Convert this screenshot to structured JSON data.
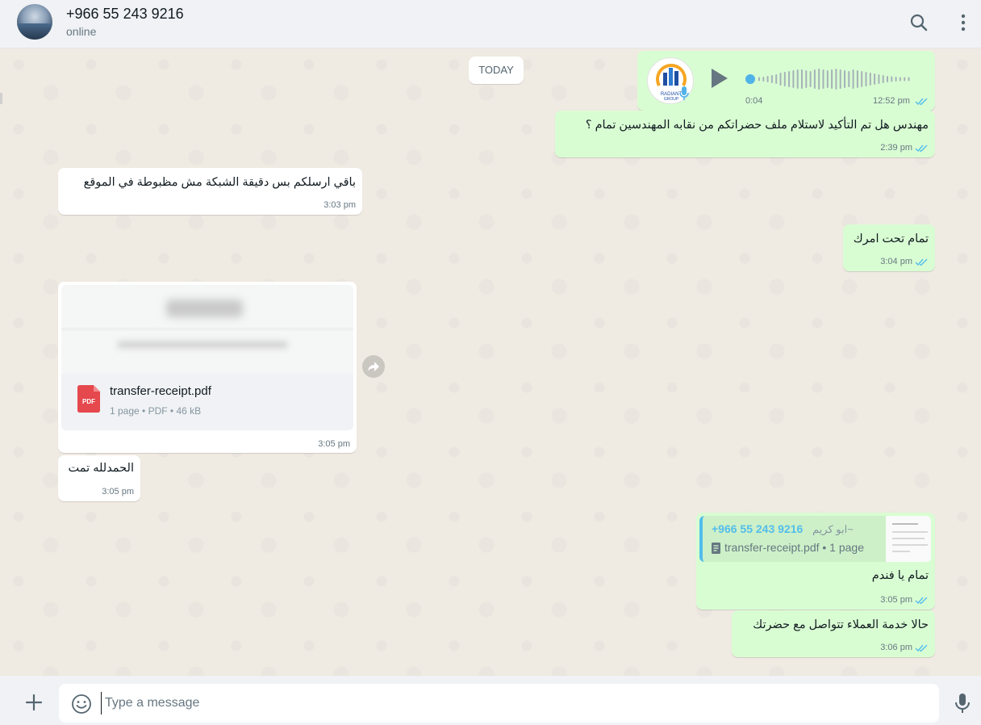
{
  "header": {
    "contact_name": "+966 55 243 9216",
    "status": "online",
    "icons": [
      "search-icon",
      "menu-icon"
    ]
  },
  "chat": {
    "date_divider": "TODAY",
    "voice_note": {
      "duration": "0:04",
      "time": "12:52 pm",
      "avatar_brand": "RADIANT GROUP"
    },
    "messages": [
      {
        "dir": "out",
        "text": "مهندس هل تم التأكيد لاستلام ملف حضراتكم من نقابه المهندسين تمام ؟",
        "time": "2:39 pm"
      },
      {
        "dir": "in",
        "text": "باقي ارسلكم بس دقيقة الشبكة مش مظبوطة في الموقع",
        "time": "3:03 pm"
      },
      {
        "dir": "out",
        "text": "تمام تحت امرك",
        "time": "3:04 pm"
      },
      {
        "dir": "in",
        "text": "الحمدلله تمت",
        "time": "3:05 pm"
      },
      {
        "dir": "out",
        "text": "تمام يا فندم",
        "time": "3:05 pm"
      },
      {
        "dir": "out",
        "text": "حالا خدمة العملاء تتواصل مع حضرتك",
        "time": "3:06 pm"
      }
    ],
    "document": {
      "file_name": "transfer-receipt.pdf",
      "meta": "1 page • PDF • 46 kB",
      "icon_label": "PDF",
      "time": "3:05 pm"
    },
    "quoted": {
      "author": "+966 55 243 9216",
      "push_name": "~ابو كريم",
      "doc": "transfer-receipt.pdf • 1 page"
    }
  },
  "composer": {
    "placeholder": "Type a message"
  },
  "colors": {
    "outgoing_bubble": "#d9fdd3",
    "incoming_bubble": "#ffffff",
    "chat_background": "#efeae2",
    "read_ticks": "#53bdeb",
    "header_background": "#f0f2f5"
  }
}
